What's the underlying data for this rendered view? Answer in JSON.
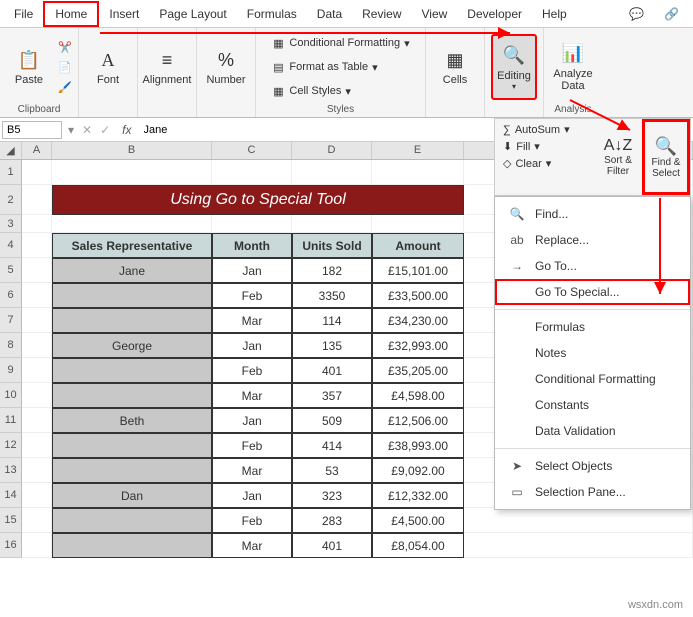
{
  "tabs": {
    "file": "File",
    "home": "Home",
    "insert": "Insert",
    "page_layout": "Page Layout",
    "formulas": "Formulas",
    "data": "Data",
    "review": "Review",
    "view": "View",
    "developer": "Developer",
    "help": "Help"
  },
  "ribbon": {
    "clipboard": {
      "paste": "Paste",
      "label": "Clipboard"
    },
    "font": {
      "label": "Font"
    },
    "alignment": {
      "label": "Alignment"
    },
    "number": {
      "label": "Number"
    },
    "styles": {
      "cond": "Conditional Formatting",
      "table": "Format as Table",
      "cell": "Cell Styles",
      "label": "Styles"
    },
    "cells": {
      "label": "Cells"
    },
    "editing": {
      "label": "Editing"
    },
    "analysis": {
      "analyze": "Analyze Data",
      "label": "Analysis"
    }
  },
  "namebox": "B5",
  "formula": "Jane",
  "columns": {
    "A": "A",
    "B": "B",
    "C": "C",
    "D": "D",
    "E": "E"
  },
  "banner": "Using Go to Special Tool",
  "headers": {
    "rep": "Sales Representative",
    "month": "Month",
    "units": "Units Sold",
    "amount": "Amount"
  },
  "data_rows": [
    {
      "r": "5",
      "rep": "Jane",
      "month": "Jan",
      "units": "182",
      "amount": "£15,101.00"
    },
    {
      "r": "6",
      "rep": "",
      "month": "Feb",
      "units": "3350",
      "amount": "£33,500.00"
    },
    {
      "r": "7",
      "rep": "",
      "month": "Mar",
      "units": "114",
      "amount": "£34,230.00"
    },
    {
      "r": "8",
      "rep": "George",
      "month": "Jan",
      "units": "135",
      "amount": "£32,993.00"
    },
    {
      "r": "9",
      "rep": "",
      "month": "Feb",
      "units": "401",
      "amount": "£35,205.00"
    },
    {
      "r": "10",
      "rep": "",
      "month": "Mar",
      "units": "357",
      "amount": "£4,598.00"
    },
    {
      "r": "11",
      "rep": "Beth",
      "month": "Jan",
      "units": "509",
      "amount": "£12,506.00"
    },
    {
      "r": "12",
      "rep": "",
      "month": "Feb",
      "units": "414",
      "amount": "£38,993.00"
    },
    {
      "r": "13",
      "rep": "",
      "month": "Mar",
      "units": "53",
      "amount": "£9,092.00"
    },
    {
      "r": "14",
      "rep": "Dan",
      "month": "Jan",
      "units": "323",
      "amount": "£12,332.00"
    },
    {
      "r": "15",
      "rep": "",
      "month": "Feb",
      "units": "283",
      "amount": "£4,500.00"
    },
    {
      "r": "16",
      "rep": "",
      "month": "Mar",
      "units": "401",
      "amount": "£8,054.00"
    }
  ],
  "editing_panel": {
    "autosum": "AutoSum",
    "fill": "Fill",
    "clear": "Clear",
    "sort": "Sort & Filter",
    "find": "Find & Select"
  },
  "menu": {
    "find": "Find...",
    "replace": "Replace...",
    "goto": "Go To...",
    "special": "Go To Special...",
    "formulas": "Formulas",
    "notes": "Notes",
    "cond": "Conditional Formatting",
    "constants": "Constants",
    "validation": "Data Validation",
    "objects": "Select Objects",
    "pane": "Selection Pane..."
  },
  "watermark": "wsxdn.com"
}
